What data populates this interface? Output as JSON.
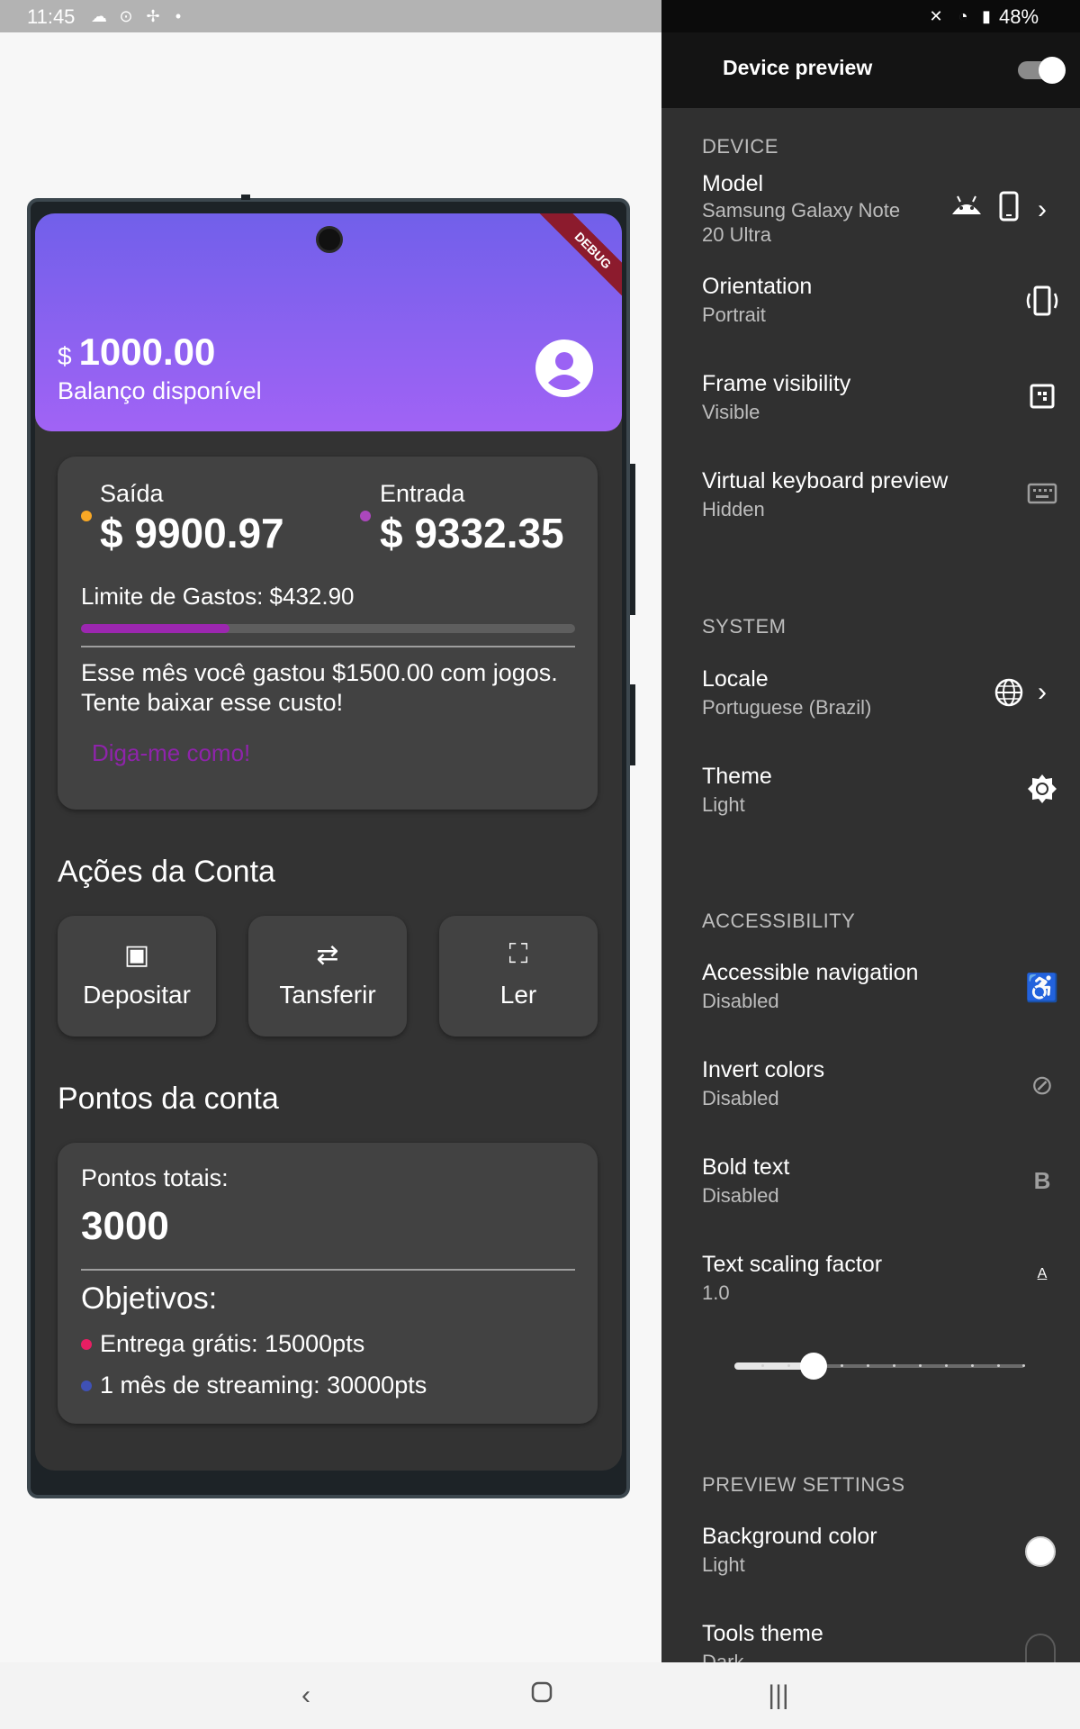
{
  "status_bar": {
    "time": "11:45",
    "battery": "48%"
  },
  "app": {
    "balance": {
      "currency": "$",
      "amount": "1000.00",
      "label": "Balanço disponível"
    },
    "debug_label": "DEBUG",
    "summary": {
      "out_label": "Saída",
      "out_amount": "$ 9900.97",
      "in_label": "Entrada",
      "in_amount": "$ 9332.35",
      "limit_text": "Limite de Gastos: $432.90",
      "limit_progress": 0.3,
      "message": "Esse mês você gastou $1500.00 com jogos. Tente baixar esse custo!",
      "link": "Diga-me como!"
    },
    "actions": {
      "title": "Ações da Conta",
      "items": [
        {
          "label": "Depositar",
          "icon": "wallet-icon"
        },
        {
          "label": "Tansferir",
          "icon": "transfer-icon"
        },
        {
          "label": "Ler",
          "icon": "scan-icon"
        }
      ]
    },
    "points": {
      "title": "Pontos da conta",
      "total_label": "Pontos totais:",
      "total_value": "3000",
      "goals_title": "Objetivos:",
      "goals": [
        {
          "text": "Entrega grátis: 15000pts",
          "color": "#e91e63"
        },
        {
          "text": "1 mês de streaming: 30000pts",
          "color": "#3f51b5"
        }
      ]
    }
  },
  "panel": {
    "title": "Device preview",
    "toggle_on": true,
    "sections": {
      "device": "DEVICE",
      "system": "SYSTEM",
      "accessibility": "ACCESSIBILITY",
      "preview": "PREVIEW SETTINGS"
    },
    "items": {
      "model": {
        "title": "Model",
        "sub": "Samsung Galaxy Note 20 Ultra"
      },
      "orientation": {
        "title": "Orientation",
        "sub": "Portrait"
      },
      "frame": {
        "title": "Frame visibility",
        "sub": "Visible"
      },
      "keyboard": {
        "title": "Virtual keyboard preview",
        "sub": "Hidden"
      },
      "locale": {
        "title": "Locale",
        "sub": "Portuguese (Brazil)"
      },
      "theme": {
        "title": "Theme",
        "sub": "Light"
      },
      "acc_nav": {
        "title": "Accessible navigation",
        "sub": "Disabled"
      },
      "invert": {
        "title": "Invert colors",
        "sub": "Disabled"
      },
      "bold": {
        "title": "Bold text",
        "sub": "Disabled"
      },
      "scaling": {
        "title": "Text scaling factor",
        "sub": "1.0"
      },
      "bg_color": {
        "title": "Background color",
        "sub": "Light"
      },
      "tools_theme": {
        "title": "Tools theme",
        "sub": "Dark"
      }
    },
    "text_scale_value": 1.0
  }
}
